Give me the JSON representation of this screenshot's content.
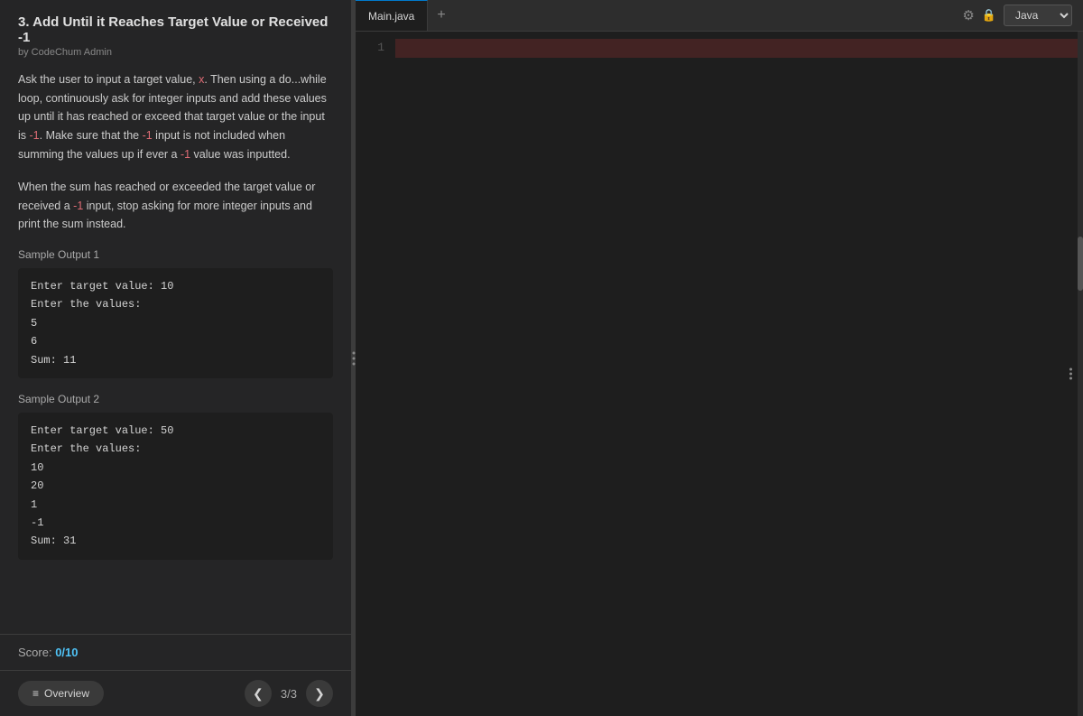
{
  "leftPanel": {
    "problemTitle": "3. Add Until it Reaches Target Value or Received -1",
    "problemAuthor": "by CodeChum Admin",
    "description": {
      "paragraph1_part1": "Ask the user to input a target value, ",
      "paragraph1_x": "x",
      "paragraph1_part2": ". Then using a do...while loop, continuously ask for integer inputs and add these values up until it has reached or exceed that target value or the input is ",
      "paragraph1_neg1": "-1",
      "paragraph1_part3": ". Make sure that the ",
      "paragraph1_neg1b": "-1",
      "paragraph1_part4": " input is not included when summing the values up if ever a ",
      "paragraph1_neg1c": "-1",
      "paragraph1_part5": " value was inputted.",
      "paragraph2_part1": "When the sum has reached or exceeded the target value or received a ",
      "paragraph2_neg1": "-1",
      "paragraph2_part2": " input, stop asking for more integer inputs and print the sum instead."
    },
    "sample1Label": "Sample Output 1",
    "sample1Code": "Enter target value: 10\nEnter the values:\n5\n6\nSum: 11",
    "sample2Label": "Sample Output 2",
    "sample2Code": "Enter target value: 50\nEnter the values:\n10\n20\n1\n-1\nSum: 31",
    "scoreLabel": "Score:",
    "scoreValue": "0/10",
    "overviewBtn": "≡  Overview",
    "navPage": "3/3"
  },
  "editorPanel": {
    "tabName": "Main.java",
    "addTabIcon": "+",
    "gearIcon": "⚙",
    "lockIcon": "🔒",
    "langLabel": "Java",
    "lineNumber": "1"
  }
}
